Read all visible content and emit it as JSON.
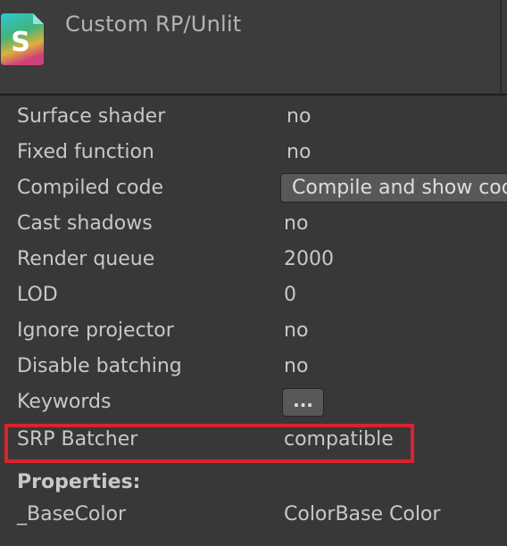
{
  "header": {
    "icon_letter": "S",
    "title": "Custom RP/Unlit"
  },
  "rows": [
    {
      "label": "Surface shader",
      "value": "no"
    },
    {
      "label": "Fixed function",
      "value": "no"
    },
    {
      "label": "Compiled code",
      "button_label": "Compile and show code"
    },
    {
      "label": "Cast shadows",
      "value": "no"
    },
    {
      "label": "Render queue",
      "value": "2000"
    },
    {
      "label": "LOD",
      "value": "0"
    },
    {
      "label": "Ignore projector",
      "value": "no"
    },
    {
      "label": "Disable batching",
      "value": "no"
    },
    {
      "label": "Keywords",
      "button_label": "..."
    },
    {
      "label": "SRP Batcher",
      "value": "compatible"
    }
  ],
  "properties": {
    "heading": "Properties:",
    "items": [
      {
        "name": "_BaseColor",
        "value": "ColorBase Color"
      }
    ]
  },
  "colors": {
    "background": "#383838",
    "header_background": "#3c3c3c",
    "highlight": "#d9232f",
    "button": "#585858"
  }
}
